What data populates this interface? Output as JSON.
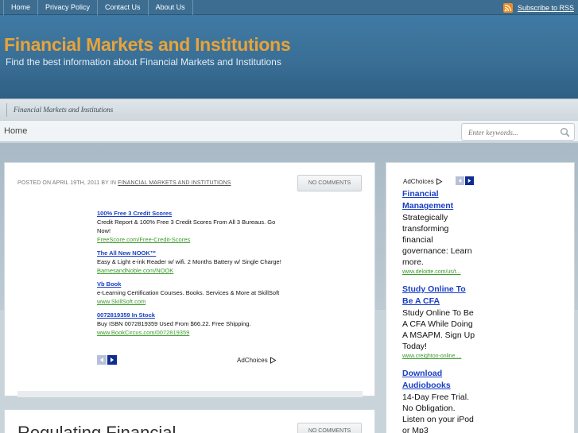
{
  "topnav": {
    "items": [
      "Home",
      "Privacy Policy",
      "Contact Us",
      "About Us"
    ],
    "rss_label": "Subscribe to RSS"
  },
  "header": {
    "title": "Financial Markets and Institutions",
    "description": "Find the best information about Financial Markets and Institutions"
  },
  "breadcrumb": {
    "label": "Financial Markets and Institutions"
  },
  "homebar": {
    "home_label": "Home",
    "search_placeholder": "Enter keywords..."
  },
  "post": {
    "meta_prefix": "POSTED ON APRIL 19TH, 2011 BY IN",
    "category": "FINANCIAL MARKETS AND INSTITUTIONS",
    "comments": "NO COMMENTS",
    "ads": [
      {
        "title": "100% Free 3 Credit Scores",
        "body": "Credit Report & 100% Free 3 Credit Scores From All 3 Bureaus. Go Now!",
        "url": "FreeScore.com/Free-Credit-Scores"
      },
      {
        "title": "The All New NOOK™",
        "body": "Easy & Light e-ink Reader w/ wifi. 2 Months Battery w/ Single Charge!",
        "url": "BarnesandNoble.com/NOOK"
      },
      {
        "title": "Vb Book",
        "body": "e-Learning Certification Courses. Books. Services & More at SkillSoft",
        "url": "www.SkillSoft.com"
      },
      {
        "title": "0072819359 In Stock",
        "body": "Buy ISBN 0072819359 Used From $66.22. Free Shipping.",
        "url": "www.BookCircus.com/0072819359"
      }
    ],
    "adchoices_label": "AdChoices"
  },
  "post2": {
    "title": "Regulating Financial",
    "comments": "NO COMMENTS"
  },
  "sidebar": {
    "adchoices_label": "AdChoices",
    "ads": [
      {
        "title": "Financial Management",
        "body": "Strategically transforming financial governance: Learn more.",
        "url": "www.deloitte.com/us/t..."
      },
      {
        "title": "Study Online To Be A CFA",
        "body": "Study Online To Be A CFA While Doing A MSAPM. Sign Up Today!",
        "url": "www.creighton-online...."
      },
      {
        "title": "Download Audiobooks",
        "body": "14-Day Free Trial. No Obligation. Listen on your iPod or Mp3",
        "url": ""
      }
    ]
  },
  "colors": {
    "title_orange": "#e8a33a",
    "header_blue": "#3a6f96",
    "ad_link_blue": "#1a3fc4",
    "ad_url_green": "#3a9a2a",
    "rss_orange": "#f28b1e"
  }
}
